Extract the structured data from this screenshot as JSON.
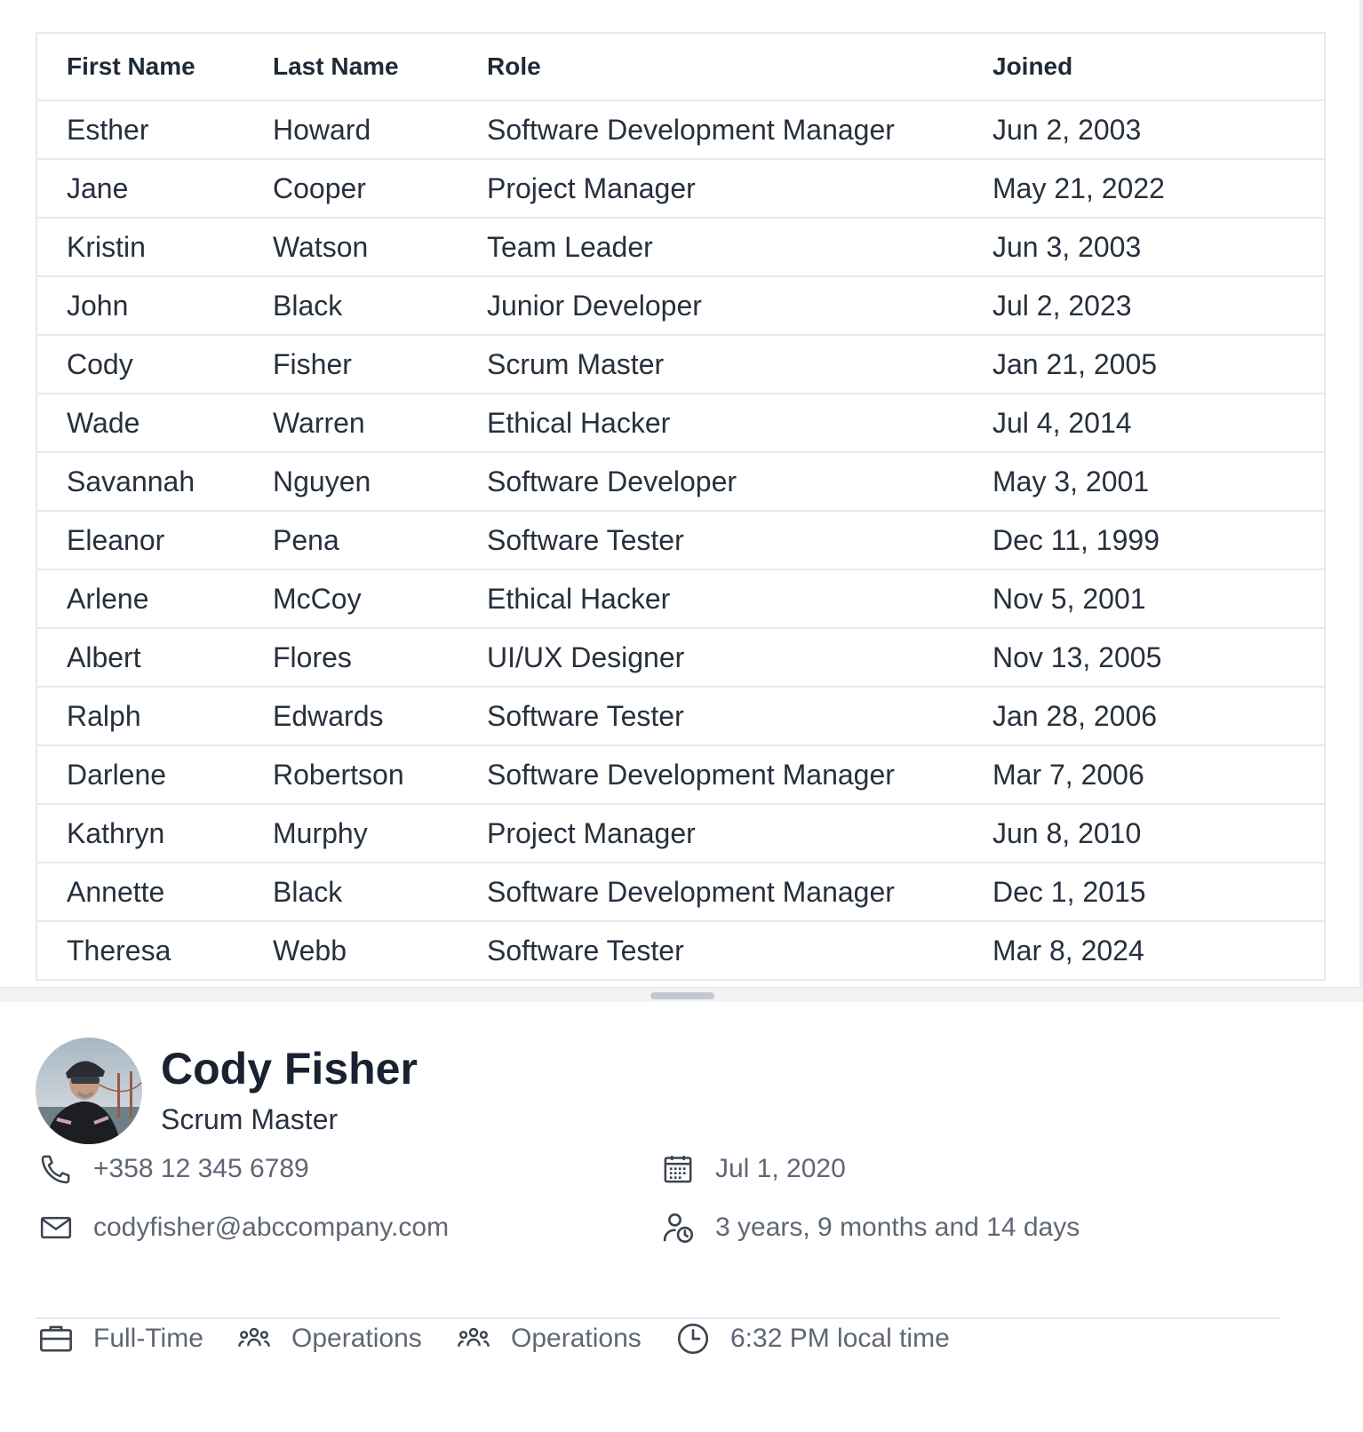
{
  "table": {
    "columns": [
      "First Name",
      "Last Name",
      "Role",
      "Joined"
    ],
    "rows": [
      {
        "first": "Esther",
        "last": "Howard",
        "role": "Software Development Manager",
        "joined": "Jun 2, 2003"
      },
      {
        "first": "Jane",
        "last": "Cooper",
        "role": "Project Manager",
        "joined": "May 21, 2022"
      },
      {
        "first": "Kristin",
        "last": "Watson",
        "role": "Team Leader",
        "joined": "Jun 3, 2003"
      },
      {
        "first": "John",
        "last": "Black",
        "role": "Junior Developer",
        "joined": "Jul 2, 2023"
      },
      {
        "first": "Cody",
        "last": "Fisher",
        "role": "Scrum Master",
        "joined": "Jan 21, 2005"
      },
      {
        "first": "Wade",
        "last": "Warren",
        "role": "Ethical Hacker",
        "joined": "Jul 4, 2014"
      },
      {
        "first": "Savannah",
        "last": "Nguyen",
        "role": "Software Developer",
        "joined": "May 3, 2001"
      },
      {
        "first": "Eleanor",
        "last": "Pena",
        "role": "Software Tester",
        "joined": "Dec 11, 1999"
      },
      {
        "first": "Arlene",
        "last": "McCoy",
        "role": "Ethical Hacker",
        "joined": "Nov 5, 2001"
      },
      {
        "first": "Albert",
        "last": "Flores",
        "role": "UI/UX Designer",
        "joined": "Nov 13, 2005"
      },
      {
        "first": "Ralph",
        "last": "Edwards",
        "role": "Software Tester",
        "joined": "Jan 28, 2006"
      },
      {
        "first": "Darlene",
        "last": "Robertson",
        "role": "Software Development Manager",
        "joined": "Mar 7, 2006"
      },
      {
        "first": "Kathryn",
        "last": "Murphy",
        "role": "Project Manager",
        "joined": "Jun 8, 2010"
      },
      {
        "first": "Annette",
        "last": "Black",
        "role": "Software Development Manager",
        "joined": "Dec 1, 2015"
      },
      {
        "first": "Theresa",
        "last": "Webb",
        "role": "Software Tester",
        "joined": "Mar 8, 2024"
      }
    ]
  },
  "profile": {
    "name": "Cody Fisher",
    "title": "Scrum Master",
    "phone": "+358 12 345 6789",
    "email": "codyfisher@abccompany.com",
    "start_date": "Jul 1, 2020",
    "tenure": "3 years, 9 months and 14 days",
    "employment_type": "Full-Time",
    "department": "Operations",
    "team": "Operations",
    "local_time": "6:32 PM local time"
  },
  "icons": {
    "phone": "phone-icon",
    "email": "mail-icon",
    "start_date": "calendar-icon",
    "tenure": "person-clock-icon",
    "employment_type": "briefcase-icon",
    "department": "people-group-icon",
    "team": "people-group-icon",
    "local_time": "clock-icon"
  },
  "colors": {
    "text_primary": "#1a2231",
    "text_secondary": "#5f6775",
    "border": "#e6e8ec"
  }
}
